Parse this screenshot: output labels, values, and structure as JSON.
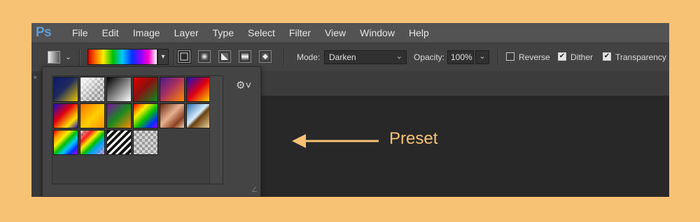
{
  "menubar": {
    "logo": "Ps",
    "items": [
      "File",
      "Edit",
      "Image",
      "Layer",
      "Type",
      "Select",
      "Filter",
      "View",
      "Window",
      "Help"
    ]
  },
  "options": {
    "mode_label": "Mode:",
    "mode_value": "Darken",
    "opacity_label": "Opacity:",
    "opacity_value": "100%",
    "reverse_label": "Reverse",
    "reverse_checked": false,
    "dither_label": "Dither",
    "dither_checked": true,
    "transparency_label": "Transparency",
    "transparency_checked": true,
    "gradient_types": [
      "linear",
      "radial",
      "angle",
      "reflected",
      "diamond"
    ],
    "selected_gradient_type": "linear"
  },
  "presets_panel": {
    "settings_icon": "gear-icon",
    "presets": [
      "blue-yellow-diagonal",
      "transparent-checker-white",
      "black-white",
      "red-green",
      "violet-orange",
      "blue-red-yellow",
      "blue-red-yellow-2",
      "yellow-orange",
      "violet-green-orange",
      "rainbow-diagonal",
      "copper",
      "chrome",
      "spectrum",
      "transparent-rainbow",
      "transparent-stripes",
      "transparent"
    ]
  },
  "annotation": {
    "label": "Preset",
    "color": "#f7c274"
  }
}
